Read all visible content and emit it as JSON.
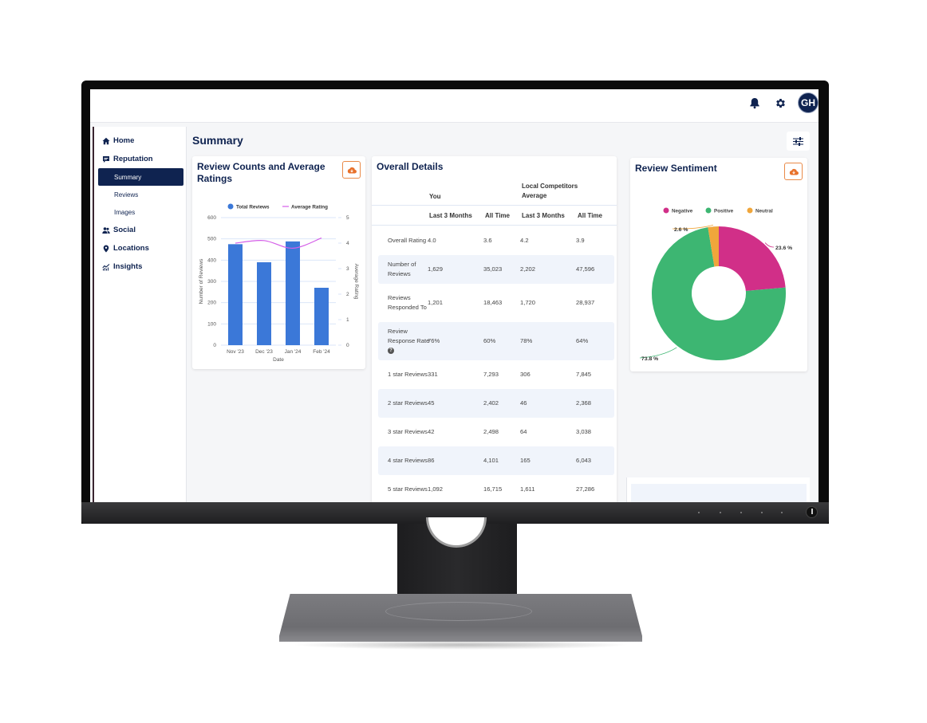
{
  "topbar": {
    "notification_icon": "bell-icon",
    "settings_icon": "gear-icon",
    "avatar_initials": "GH"
  },
  "sidebar": {
    "items": [
      {
        "label": "Home",
        "icon": "home-icon"
      },
      {
        "label": "Reputation",
        "icon": "chat-icon",
        "children": [
          {
            "label": "Summary",
            "active": true
          },
          {
            "label": "Reviews",
            "active": false
          },
          {
            "label": "Images",
            "active": false
          }
        ]
      },
      {
        "label": "Social",
        "icon": "users-icon"
      },
      {
        "label": "Locations",
        "icon": "map-pin-icon"
      },
      {
        "label": "Insights",
        "icon": "chart-line-icon"
      }
    ]
  },
  "page": {
    "title": "Summary",
    "filter_icon": "sliders-icon"
  },
  "colors": {
    "brand_navy": "#0f2350",
    "bar_blue": "#3b78d8",
    "line_magenta": "#d45ee8",
    "negative": "#d12f88",
    "positive": "#3db672",
    "neutral": "#f0a63b",
    "download_orange": "#e8712b"
  },
  "review_counts_card": {
    "title": "Review Counts and Average Ratings",
    "download_icon": "cloud-download-icon"
  },
  "overall_details": {
    "title": "Overall Details",
    "group_headers": [
      "You",
      "Local Competitors Average"
    ],
    "column_headers": [
      "Last 3 Months",
      "All Time",
      "Last 3 Months",
      "All Time"
    ],
    "rows": [
      {
        "label": "Overall Rating",
        "values": [
          "4.0",
          "3.6",
          "4.2",
          "3.9"
        ]
      },
      {
        "label": "Number of Reviews",
        "values": [
          "1,629",
          "35,023",
          "2,202",
          "47,596"
        ]
      },
      {
        "label": "Reviews Responded To",
        "values": [
          "1,201",
          "18,463",
          "1,720",
          "28,937"
        ]
      },
      {
        "label": "Review Response Rate",
        "values": [
          "76%",
          "60%",
          "78%",
          "64%"
        ],
        "help": true
      },
      {
        "label": "1 star Reviews",
        "values": [
          "331",
          "7,293",
          "306",
          "7,845"
        ]
      },
      {
        "label": "2 star Reviews",
        "values": [
          "45",
          "2,402",
          "46",
          "2,368"
        ]
      },
      {
        "label": "3 star Reviews",
        "values": [
          "42",
          "2,498",
          "64",
          "3,038"
        ]
      },
      {
        "label": "4 star Reviews",
        "values": [
          "86",
          "4,101",
          "165",
          "6,043"
        ]
      },
      {
        "label": "5 star Reviews",
        "values": [
          "1,092",
          "16,715",
          "1,611",
          "27,286"
        ]
      }
    ]
  },
  "review_sentiment_card": {
    "title": "Review Sentiment",
    "download_icon": "cloud-download-icon"
  },
  "chart_data": [
    {
      "type": "bar",
      "title": "Review Counts and Average Ratings",
      "categories": [
        "Nov '23",
        "Dec '23",
        "Jan '24",
        "Feb '24"
      ],
      "series": [
        {
          "name": "Total Reviews",
          "type": "bar",
          "axis": "left",
          "values": [
            475,
            390,
            488,
            270
          ]
        },
        {
          "name": "Average Rating",
          "type": "line",
          "axis": "right",
          "values": [
            4.0,
            4.1,
            3.8,
            4.2
          ]
        }
      ],
      "xlabel": "Date",
      "ylabel": "Number of Reviews",
      "y2label": "Average Rating",
      "ylim": [
        0,
        600
      ],
      "yticks": [
        0,
        100,
        200,
        300,
        400,
        500,
        600
      ],
      "y2lim": [
        0,
        5
      ],
      "y2ticks": [
        0,
        1,
        2,
        3,
        4,
        5
      ],
      "grid": true,
      "legend": "top"
    },
    {
      "type": "pie",
      "title": "Review Sentiment",
      "donut": true,
      "labels": [
        "Negative",
        "Positive",
        "Neutral"
      ],
      "values": [
        23.6,
        73.8,
        2.6
      ],
      "value_labels": [
        "23.6 %",
        "73.8 %",
        "2.6 %"
      ],
      "legend": "top"
    }
  ]
}
